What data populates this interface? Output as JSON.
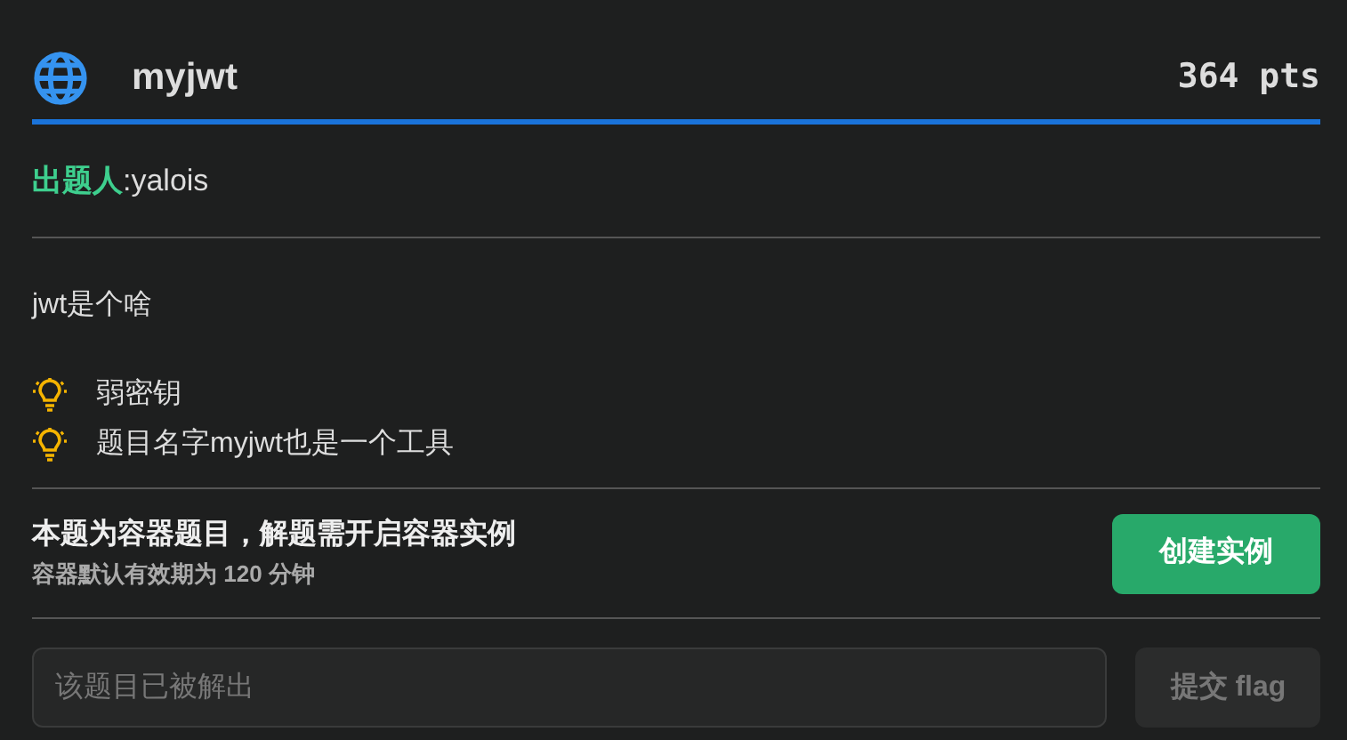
{
  "challenge": {
    "title": "myjwt",
    "points": "364 pts"
  },
  "author": {
    "label": "出题人",
    "separator": ":",
    "name": "yalois"
  },
  "description": "jwt是个啥",
  "hints": [
    "弱密钥",
    "题目名字myjwt也是一个工具"
  ],
  "container": {
    "title": "本题为容器题目，解题需开启容器实例",
    "subtitle": "容器默认有效期为 120 分钟",
    "button": "创建实例"
  },
  "flag_form": {
    "placeholder": "该题目已被解出",
    "disabled": true,
    "submit": "提交 flag"
  }
}
